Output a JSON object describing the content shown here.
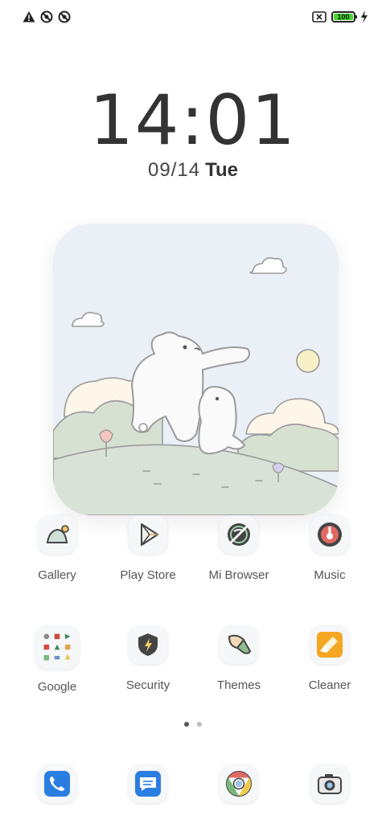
{
  "status_bar": {
    "left_icons": [
      "warning-icon",
      "no-sync-icon",
      "no-sync-icon"
    ],
    "right_icons": [
      "sim-off-icon",
      "battery-icon",
      "charging-bolt-icon"
    ],
    "battery_level": "100"
  },
  "lock": {
    "time": "14:01",
    "date": "09/14",
    "day": "Tue"
  },
  "widget": {
    "name": "bears-photo-widget"
  },
  "apps_row1": [
    {
      "label": "Gallery",
      "icon": "gallery-icon"
    },
    {
      "label": "Play Store",
      "icon": "play-store-icon"
    },
    {
      "label": "Mi Browser",
      "icon": "mi-browser-icon"
    },
    {
      "label": "Music",
      "icon": "music-icon"
    }
  ],
  "apps_row2": [
    {
      "label": "Google",
      "icon": "google-folder-icon"
    },
    {
      "label": "Security",
      "icon": "security-icon"
    },
    {
      "label": "Themes",
      "icon": "themes-icon"
    },
    {
      "label": "Cleaner",
      "icon": "cleaner-icon"
    }
  ],
  "pager": {
    "pages": 2,
    "current": 1
  },
  "dock": [
    {
      "icon": "phone-icon"
    },
    {
      "icon": "messages-icon"
    },
    {
      "icon": "chrome-icon"
    },
    {
      "icon": "camera-icon"
    }
  ],
  "colors": {
    "battery_fill": "#44d62c",
    "phone_blue": "#2a7de1",
    "cleaner_orange": "#f5a623",
    "music_red": "#e06a63"
  }
}
